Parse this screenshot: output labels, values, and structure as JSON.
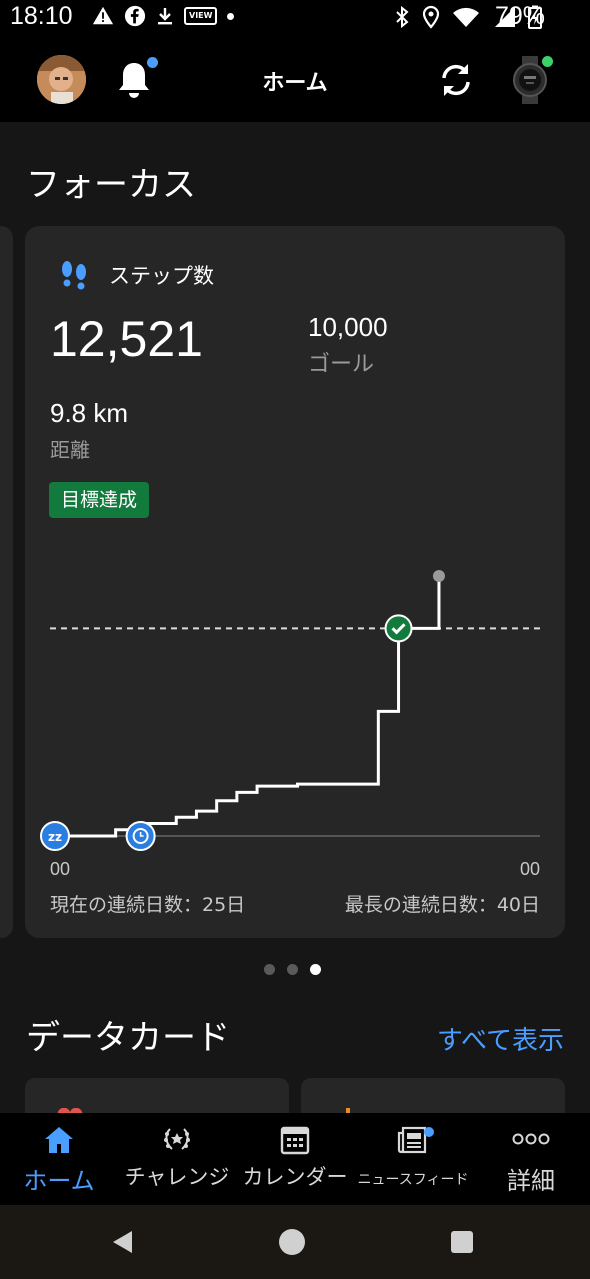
{
  "status_bar": {
    "time": "18:10",
    "battery_percent": "79%",
    "view_badge": "VIEW"
  },
  "header": {
    "title": "ホーム"
  },
  "focus": {
    "section_title": "フォーカス",
    "card": {
      "label": "ステップ数",
      "steps_value": "12,521",
      "goal_value": "10,000",
      "goal_label": "ゴール",
      "distance_value": "9.8 km",
      "distance_label": "距離",
      "badge": "目標達成",
      "axis_start": "00",
      "axis_end": "00",
      "current_streak": "現在の連続日数：25日",
      "longest_streak": "最長の連続日数：40日"
    }
  },
  "pager": {
    "count": 3,
    "active_index": 2
  },
  "data_cards": {
    "section_title": "データカード",
    "show_all": "すべて表示"
  },
  "bottom_nav": {
    "items": [
      {
        "label": "ホーム",
        "icon": "home-icon",
        "active": true
      },
      {
        "label": "チャレンジ",
        "icon": "laurel-icon",
        "active": false
      },
      {
        "label": "カレンダー",
        "icon": "calendar-icon",
        "active": false
      },
      {
        "label": "ニュースフィード",
        "icon": "news-icon",
        "active": false
      },
      {
        "label": "詳細",
        "icon": "more-icon",
        "active": false
      }
    ]
  },
  "colors": {
    "accent": "#4a9eff",
    "goal_green": "#137a3d",
    "card_bg": "#262626",
    "content_bg": "#161616"
  },
  "chart_data": {
    "type": "line",
    "series_description": "cumulative daily steps",
    "goal": 10000,
    "current": 12521,
    "ylim": [
      0,
      12521
    ],
    "x": [
      0,
      3,
      4,
      6,
      7,
      8,
      9,
      10,
      12,
      14,
      16,
      17,
      19
    ],
    "y": [
      0,
      300,
      600,
      900,
      1200,
      1700,
      2100,
      2400,
      2500,
      2500,
      6000,
      10000,
      12521
    ],
    "xlabel_start": "00",
    "xlabel_end": "00",
    "markers": [
      "sleep-marker",
      "wake-marker",
      "goal-reached-marker"
    ]
  }
}
